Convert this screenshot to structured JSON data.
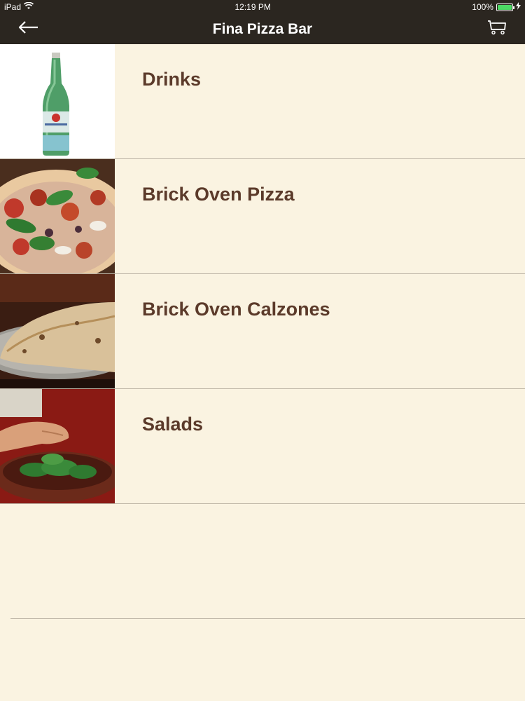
{
  "status_bar": {
    "device": "iPad",
    "time": "12:19 PM",
    "battery": "100%"
  },
  "nav": {
    "title": "Fina Pizza Bar"
  },
  "categories": [
    {
      "label": "Drinks"
    },
    {
      "label": "Brick Oven Pizza"
    },
    {
      "label": "Brick Oven Calzones"
    },
    {
      "label": "Salads"
    }
  ],
  "colors": {
    "nav_bg": "#2b2620",
    "page_bg": "#faf3e1",
    "label": "#5b3a2a",
    "divider": "#bdb5a6",
    "battery": "#4cd964"
  },
  "icons": [
    "wifi-icon",
    "battery-icon",
    "charging-icon",
    "back-arrow-icon",
    "cart-icon"
  ]
}
